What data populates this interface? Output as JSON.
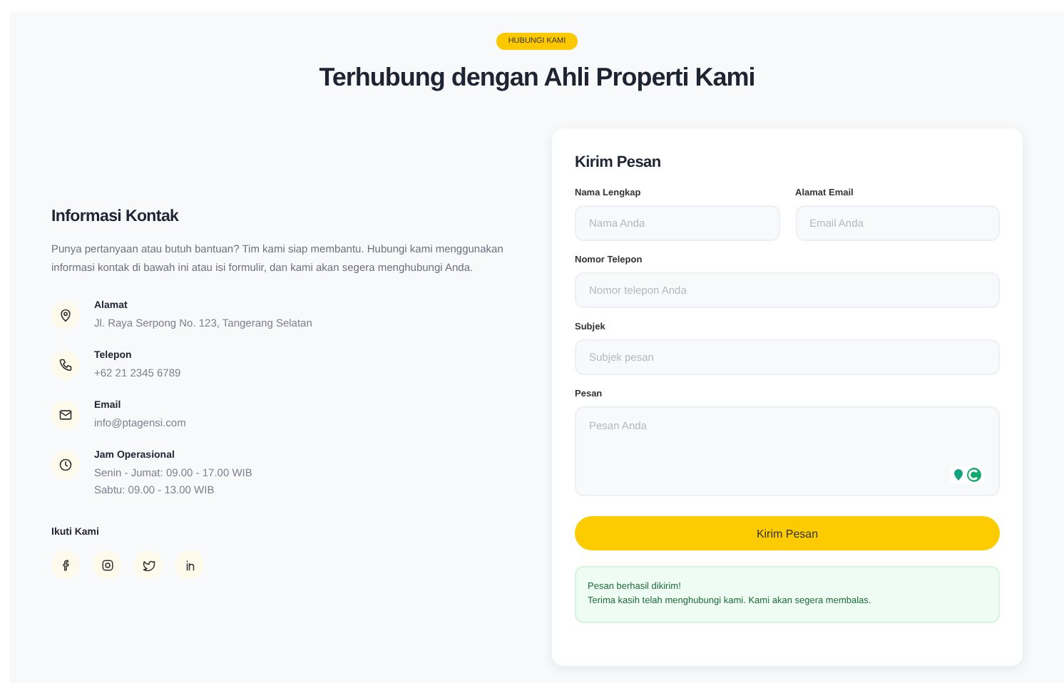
{
  "badge": "HUBUNGI KAMI",
  "title": "Terhubung dengan Ahli Properti Kami",
  "contact_info": {
    "title": "Informasi Kontak",
    "description": "Punya pertanyaan atau butuh bantuan? Tim kami siap membantu. Hubungi kami menggunakan informasi kontak di bawah ini atau isi formulir, dan kami akan segera menghubungi Anda.",
    "items": [
      {
        "kind": "address",
        "label": "Alamat",
        "lines": [
          "Jl. Raya Serpong No. 123, Tangerang Selatan"
        ]
      },
      {
        "kind": "phone",
        "label": "Telepon",
        "lines": [
          "+62 21 2345 6789"
        ]
      },
      {
        "kind": "email",
        "label": "Email",
        "lines": [
          "info@ptagensi.com"
        ]
      },
      {
        "kind": "hours",
        "label": "Jam Operasional",
        "lines": [
          "Senin - Jumat: 09.00 - 17.00 WIB",
          "Sabtu: 09.00 - 13.00 WIB"
        ]
      }
    ],
    "social_title": "Ikuti Kami",
    "social": [
      {
        "kind": "facebook"
      },
      {
        "kind": "instagram"
      },
      {
        "kind": "twitter"
      },
      {
        "kind": "linkedin"
      }
    ]
  },
  "form": {
    "title": "Kirim Pesan",
    "fields": [
      {
        "label": "Nama Lengkap",
        "placeholder": "Nama Anda",
        "kind": "half"
      },
      {
        "label": "Alamat Email",
        "placeholder": "Email Anda",
        "kind": "half"
      },
      {
        "label": "Nomor Telepon",
        "placeholder": "Nomor telepon Anda",
        "kind": "full"
      },
      {
        "label": "Subjek",
        "placeholder": "Subjek pesan",
        "kind": "full"
      },
      {
        "label": "Pesan",
        "placeholder": "Pesan Anda",
        "kind": "textarea"
      }
    ],
    "submit": "Kirim Pesan",
    "success": {
      "title": "Pesan berhasil dikirim!",
      "message": "Terima kasih telah menghubungi kami. Kami akan segera membalas."
    }
  }
}
